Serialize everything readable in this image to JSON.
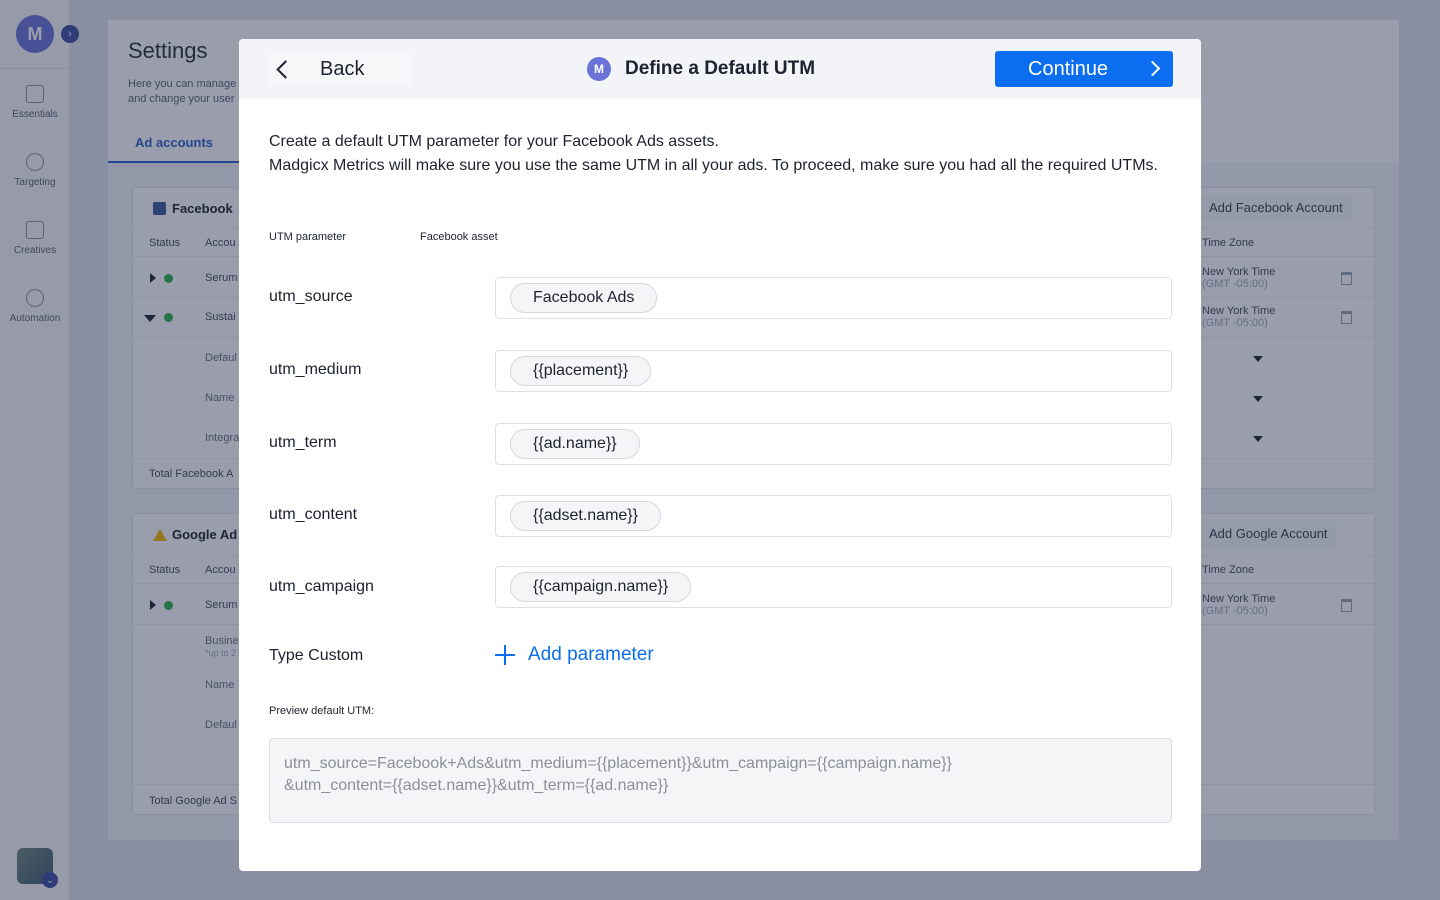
{
  "sidebar": {
    "logo": "M",
    "items": [
      {
        "label": "Essentials",
        "icon": "grid-icon"
      },
      {
        "label": "Targeting",
        "icon": "target-icon"
      },
      {
        "label": "Creatives",
        "icon": "image-icon"
      },
      {
        "label": "Automation",
        "icon": "gear-icon"
      }
    ]
  },
  "settings": {
    "title": "Settings",
    "desc_line1": "Here you can manage",
    "desc_line2": "and change your user",
    "tab": "Ad accounts",
    "facebook": {
      "title": "Facebook",
      "add_button": "Add Facebook Account",
      "col_status": "Status",
      "col_account": "Accou",
      "col_timezone": "Time Zone",
      "row1": "Serum",
      "row2": "Sustai",
      "sub1": "Defaul",
      "sub2": "Name",
      "sub3": "Integra",
      "total": "Total Facebook A",
      "tz_name": "New York Time",
      "tz_offset": "(GMT -05:00)"
    },
    "google": {
      "title": "Google Ad",
      "add_button": "Add Google Account",
      "col_status": "Status",
      "col_account": "Accou",
      "col_timezone": "Time Zone",
      "row1": "Serum",
      "sub1": "Busine",
      "sub1_note": "*up to 2",
      "sub2": "Name",
      "sub3": "Defaul",
      "total": "Total Google Ad S",
      "tz_name": "New York Time",
      "tz_offset": "(GMT -05:00)"
    }
  },
  "modal": {
    "back_label": "Back",
    "title": "Define a Default UTM",
    "continue_label": "Continue",
    "intro_line1": "Create a default UTM parameter for your Facebook Ads assets.",
    "intro_line2": "Madgicx Metrics will make sure you use the same UTM in all your ads. To proceed, make sure you had all the required UTMs.",
    "col_param": "UTM parameter",
    "col_asset": "Facebook asset",
    "params": [
      {
        "name": "utm_source",
        "value": "Facebook Ads"
      },
      {
        "name": "utm_medium",
        "value": "{{placement}}"
      },
      {
        "name": "utm_term",
        "value": "{{ad.name}}"
      },
      {
        "name": "utm_content",
        "value": "{{adset.name}}"
      },
      {
        "name": "utm_campaign",
        "value": "{{campaign.name}}"
      }
    ],
    "custom_label": "Type Custom",
    "add_param": "Add parameter",
    "preview_label": "Preview default UTM:",
    "preview_line1": "utm_source=Facebook+Ads&utm_medium={{placement}}&utm_campaign={{campaign.name}}",
    "preview_line2": "&utm_content={{adset.name}}&utm_term={{ad.name}}"
  },
  "colors": {
    "primary": "#0b6ef0",
    "brand": "#6b73d8",
    "status_green": "#2bb24c"
  }
}
